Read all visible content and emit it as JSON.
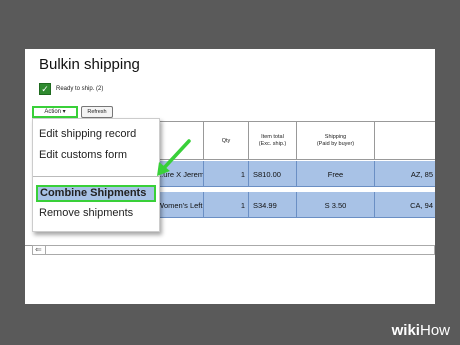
{
  "title": "Bulkin shipping",
  "ready": {
    "label": "Ready to ship. (2)",
    "checked": true
  },
  "toolbar": {
    "action_label": "Action ▾",
    "refresh_label": "Refresh"
  },
  "table": {
    "headers": [
      {
        "label": "Qty"
      },
      {
        "label": "Item total\n(Exc. ship.)"
      },
      {
        "label": "Shipping\n(Paid by buyer)"
      }
    ],
    "rows": [
      {
        "item": "...ure X Jeremy...",
        "qty": "1",
        "total": "S810.00",
        "shipping": "Free",
        "dest": "AZ, 85"
      },
      {
        "item": "Women's Left It...",
        "qty": "1",
        "total": "S34.99",
        "shipping": "S 3.50",
        "dest": "CA, 94"
      }
    ]
  },
  "menu": {
    "items": [
      "Edit shipping record",
      "Edit customs form",
      "Combine Shipments",
      "Remove shipments"
    ],
    "highlighted": "Combine Shipments"
  },
  "colors": {
    "highlight_green": "#39d039",
    "row_blue": "#a8c2e6",
    "backdrop": "#5a5a5a"
  },
  "watermark": {
    "brand": "wiki",
    "suffix": "How"
  }
}
